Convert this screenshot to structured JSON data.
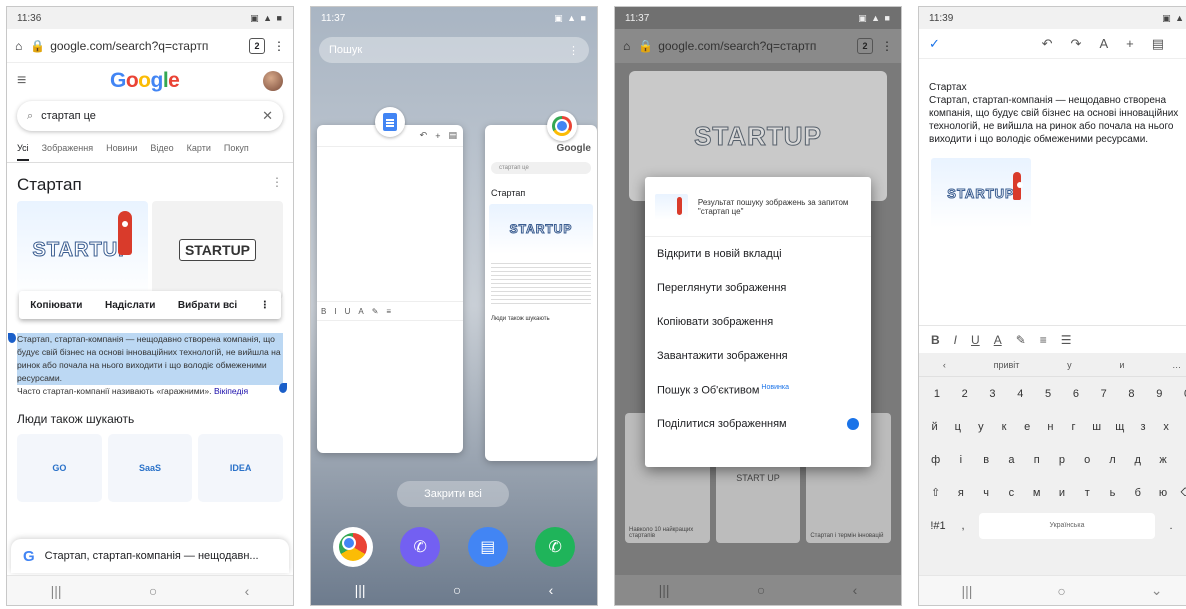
{
  "phone1": {
    "status_time": "11:36",
    "url": "google.com/search?q=стартп",
    "tab_count": "2",
    "logo": "Google",
    "search_query": "стартап це",
    "tabs": [
      "Усі",
      "Зображення",
      "Новини",
      "Відео",
      "Карти",
      "Покуп"
    ],
    "kp_title": "Стартап",
    "image_words": [
      "STARTUP",
      "STARTUP"
    ],
    "context_actions": [
      "Копіювати",
      "Надіслати",
      "Вибрати всі"
    ],
    "snippet_selected": "Стартап, стартап-компанія — нещодавно створена компанія, що будує свій бізнес на основі інноваційних технологій, не вийшла на ринок або почала на нього виходити і що володіє обмеженими ресурсами.",
    "snippet_rest": "Часто стартап-компанії називають «гаражними».",
    "wiki_link": "Вікіпедія",
    "people_title": "Люди також шукають",
    "people_cards": [
      "GO",
      "SaaS",
      "IDEA"
    ],
    "bottom_result": "Стартап, стартап-компанія — нещодавн..."
  },
  "phone2": {
    "status_time": "11:37",
    "search_placeholder": "Пошук",
    "chrome_url": "google.",
    "chrome_logo": "Google",
    "chrome_search": "стартап це",
    "chrome_heading": "Стартап",
    "chrome_img_word": "STARTUP",
    "chrome_sub": "Люди також шукають",
    "close_all": "Закрити всі",
    "docs_toolbar": [
      "+",
      "B",
      "I",
      "U",
      "A"
    ]
  },
  "phone3": {
    "status_time": "11:37",
    "url": "google.com/search?q=стартп",
    "tab_count": "2",
    "hero_word": "STARTUP",
    "tile_captions": [
      "Навколо 10 найкращих стартапів",
      "START UP",
      "Стартап і термін інновацій"
    ],
    "menu_header": "Результат пошуку зображень за запитом \"стартап це\"",
    "menu_items": [
      "Відкрити в новій вкладці",
      "Переглянути зображення",
      "Копіювати зображення",
      "Завантажити зображення",
      "Пошук з Об'єктивом",
      "Поділитися зображенням"
    ],
    "new_badge": "Новинка"
  },
  "phone4": {
    "status_time": "11:39",
    "doc_title": "Стартах",
    "doc_text": "Стартап, стартап-компанія — нещодавно створена компанія, що будує свій бізнес на основі інноваційних технологій, не вийшла на ринок або почала на нього виходити і що володіє обмеженими ресурсами.",
    "image_word": "STARTUP",
    "format_items": [
      "B",
      "I",
      "U",
      "A",
      "✎",
      "≡",
      "☰"
    ],
    "suggestions": [
      "привіт",
      "у",
      "и"
    ],
    "row_numbers": [
      "1",
      "2",
      "3",
      "4",
      "5",
      "6",
      "7",
      "8",
      "9",
      "0"
    ],
    "row1": [
      "й",
      "ц",
      "у",
      "к",
      "е",
      "н",
      "г",
      "ш",
      "щ",
      "з",
      "х",
      "ї"
    ],
    "row2": [
      "ф",
      "і",
      "в",
      "а",
      "п",
      "р",
      "о",
      "л",
      "д",
      "ж",
      "є"
    ],
    "row3": [
      "я",
      "ч",
      "с",
      "м",
      "и",
      "т",
      "ь",
      "б",
      "ю"
    ],
    "space_label": "Українська",
    "sym_key": "!#1"
  }
}
